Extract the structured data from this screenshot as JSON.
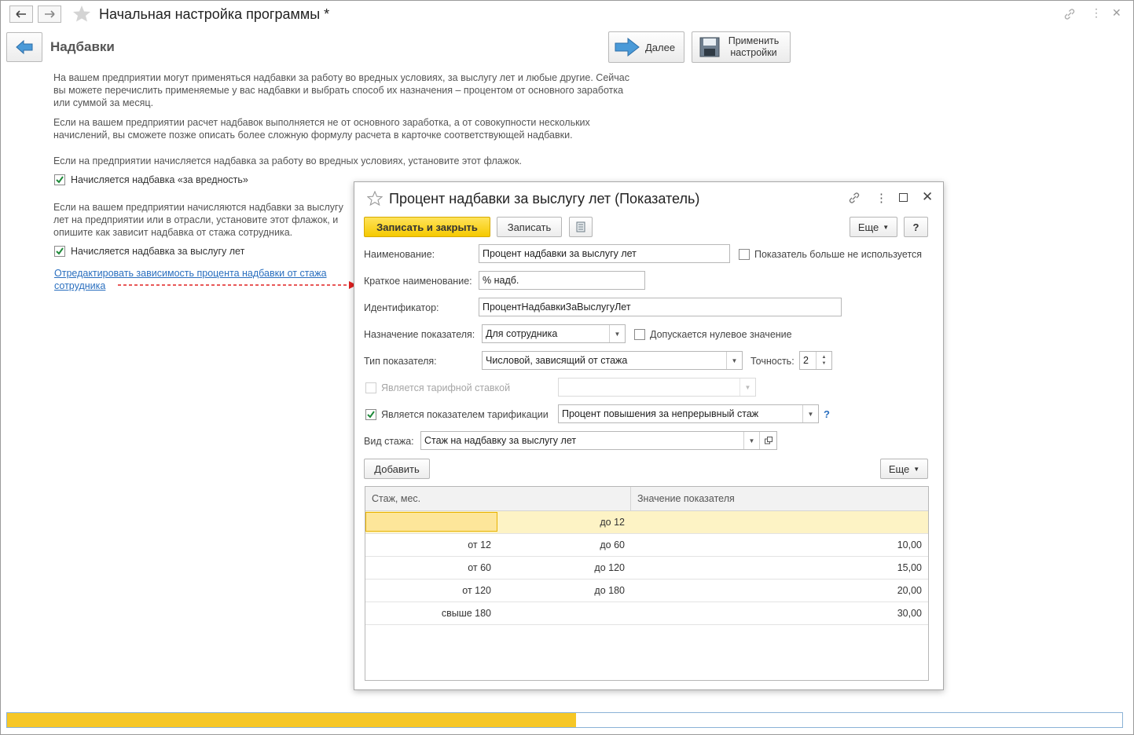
{
  "window": {
    "title": "Начальная настройка программы *",
    "back_icon": "arrow-left-icon",
    "forward_icon": "arrow-right-icon",
    "star_icon": "star-icon"
  },
  "page": {
    "title": "Надбавки",
    "next_label": "Далее",
    "apply_label": "Применить настройки",
    "para1": "На вашем предприятии могут применяться надбавки за работу во вредных условиях, за выслугу лет и любые другие. Сейчас вы можете перечислить применяемые у вас надбавки и выбрать способ их назначения – процентом от основного заработка или суммой за месяц.",
    "para2": "Если на вашем предприятии расчет надбавок выполняется не от основного заработка, а от  совокупности нескольких начислений, вы сможете позже описать более сложную формулу расчета в карточке соответствующей надбавки.",
    "para3": "Если на предприятии начисляется надбавка за работу во вредных условиях, установите этот флажок.",
    "chk_harm": "Начисляется надбавка «за вредность»",
    "para4": "Если на вашем предприятии начисляются надбавки за выслугу лет на предприятии или в отрасли, установите этот флажок, и опишите как зависит надбавка от стажа сотрудника.",
    "chk_seniority": "Начисляется надбавка за выслугу лет",
    "link": "Отредактировать зависимость процента надбавки от стажа сотрудника"
  },
  "dialog": {
    "title": "Процент надбавки за выслугу лет (Показатель)",
    "save_close": "Записать и закрыть",
    "save": "Записать",
    "more": "Еще",
    "help": "?",
    "name_label": "Наименование:",
    "name_value": "Процент надбавки за выслугу лет",
    "unused_label": "Показатель больше не используется",
    "short_label": "Краткое наименование:",
    "short_value": "% надб.",
    "id_label": "Идентификатор:",
    "id_value": "ПроцентНадбавкиЗаВыслугуЛет",
    "purpose_label": "Назначение показателя:",
    "purpose_value": "Для сотрудника",
    "zero_label": "Допускается нулевое значение",
    "type_label": "Тип показателя:",
    "type_value": "Числовой, зависящий от стажа",
    "precision_label": "Точность:",
    "precision_value": "2",
    "tariff_rate_label": "Является тарифной ставкой",
    "tariff_ind_label": "Является показателем тарификации",
    "tariff_ind_value": "Процент повышения за непрерывный стаж",
    "q_mark": "?",
    "exp_label": "Вид стажа:",
    "exp_value": "Стаж на надбавку за выслугу лет",
    "add": "Добавить",
    "more2": "Еще",
    "col1": "Стаж, мес.",
    "col2": "Значение показателя",
    "rows": [
      {
        "from": "",
        "to": "до 12",
        "value": ""
      },
      {
        "from": "от 12",
        "to": "до 60",
        "value": "10,00"
      },
      {
        "from": "от 60",
        "to": "до 120",
        "value": "15,00"
      },
      {
        "from": "от 120",
        "to": "до 180",
        "value": "20,00"
      },
      {
        "from": "свыше 180",
        "to": "",
        "value": "30,00"
      }
    ]
  },
  "progress": {
    "fraction": 0.51,
    "color": "#f6c726"
  }
}
